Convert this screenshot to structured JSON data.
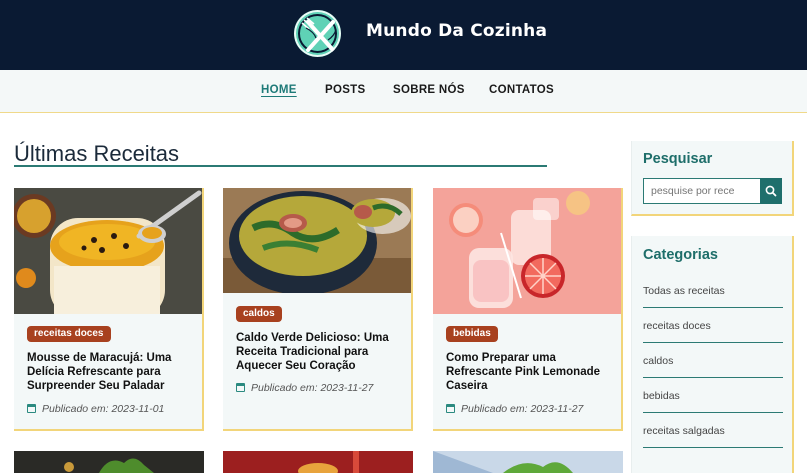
{
  "header": {
    "brand": "Mundo Da Cozinha",
    "logo_icon": "fork-knife-globe-icon"
  },
  "nav": {
    "items": [
      {
        "label": "HOME",
        "active": true
      },
      {
        "label": "POSTS",
        "active": false
      },
      {
        "label": "SOBRE NÓS",
        "active": false
      },
      {
        "label": "CONTATOS",
        "active": false
      }
    ]
  },
  "main": {
    "section_title": "Últimas Receitas",
    "cards": [
      {
        "tag": "receitas doces",
        "title": "Mousse de Maracujá: Uma Delícia Refrescante para Surpreender Seu Paladar",
        "meta": "Publicado em: 2023-11-01"
      },
      {
        "tag": "caldos",
        "title": "Caldo Verde Delicioso: Uma Receita Tradicional para Aquecer Seu Coração",
        "meta": "Publicado em: 2023-11-27"
      },
      {
        "tag": "bebidas",
        "title": "Como Preparar uma Refrescante Pink Lemonade Caseira",
        "meta": "Publicado em: 2023-11-27"
      }
    ]
  },
  "sidebar": {
    "search": {
      "title": "Pesquisar",
      "placeholder": "pesquise por rece",
      "button_icon": "search-icon"
    },
    "categories": {
      "title": "Categorias",
      "items": [
        "Todas as receitas",
        "receitas doces",
        "caldos",
        "bebidas",
        "receitas salgadas"
      ]
    }
  },
  "colors": {
    "header_bg": "#0a1a33",
    "accent": "#1e7a78",
    "tag_bg": "#a8411f",
    "card_border": "#f2d57a"
  }
}
